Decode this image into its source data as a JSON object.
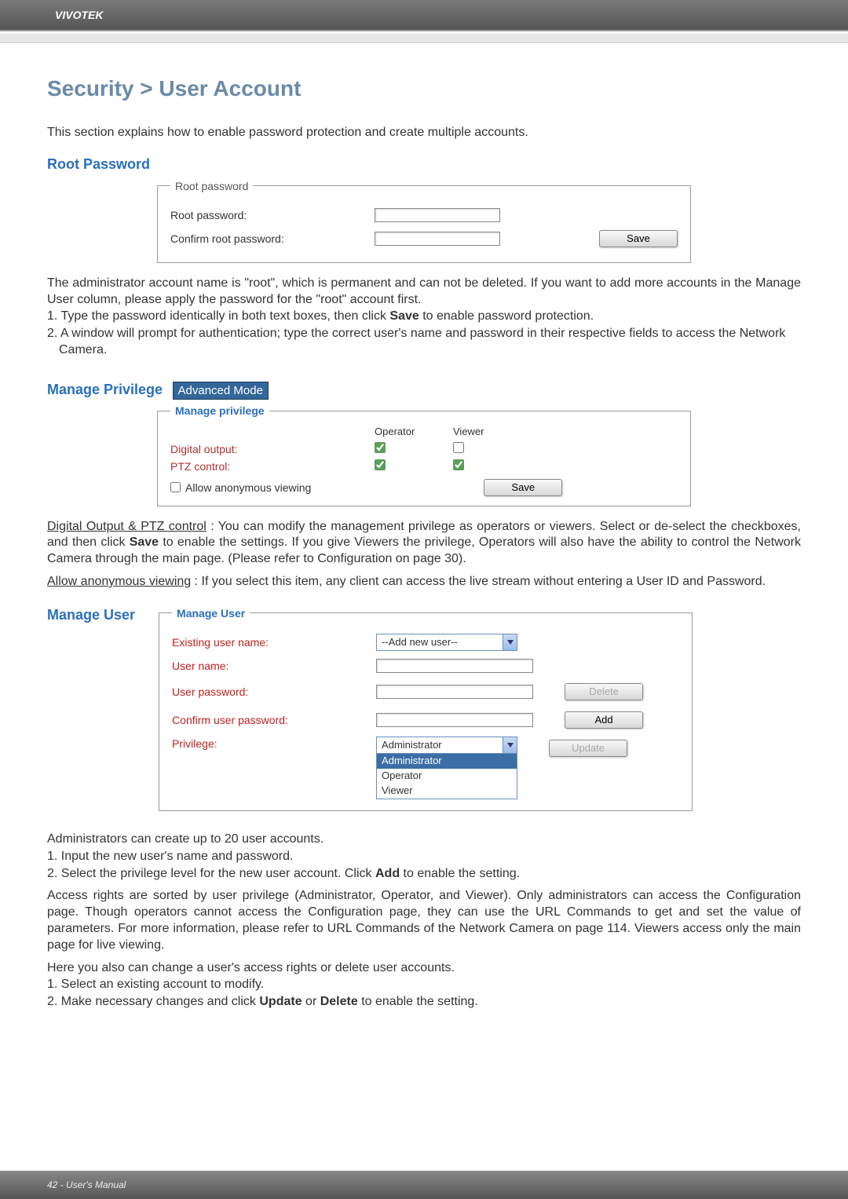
{
  "header": {
    "brand": "VIVOTEK"
  },
  "title": "Security > User Account",
  "intro": "This section explains how to enable password protection and create multiple accounts.",
  "root_password": {
    "heading": "Root Password",
    "legend": "Root password",
    "label1": "Root password:",
    "label2": "Confirm root password:",
    "save": "Save",
    "para1": "The administrator account name is \"root\", which is permanent and can not be deleted. If you want to add more accounts in the Manage User column, please apply the password for the \"root\" account first.",
    "step1": "1. Type the password identically in both text boxes, then click ",
    "step1b": "Save",
    "step1c": " to enable password protection.",
    "step2": "2. A window will prompt for authentication; type the correct user's name and password in their respective fields to access the Network Camera."
  },
  "manage_privilege": {
    "heading": "Manage Privilege",
    "badge": "Advanced Mode",
    "legend": "Manage privilege",
    "col1": "Operator",
    "col2": "Viewer",
    "row1": "Digital output:",
    "row1_op": true,
    "row1_vw": false,
    "row2": "PTZ control:",
    "row2_op": true,
    "row2_vw": true,
    "allow": "Allow anonymous viewing",
    "allow_checked": false,
    "save": "Save",
    "para_lead": "Digital Output & PTZ control",
    "para_body": ": You can modify the management privilege as operators or viewers. Select or de-select the checkboxes, and then click ",
    "para_save": "Save",
    "para_tail": " to enable the settings. If you give Viewers the privilege, Operators will also have the ability to control the Network Camera through the main page. (Please refer to Configuration on page 30).",
    "allow_lead": "Allow anonymous viewing",
    "allow_body": ": If you select this item, any client can access the live stream without entering a User ID and Password."
  },
  "manage_user": {
    "heading": "Manage User",
    "legend": "Manage User",
    "existing": "Existing user name:",
    "existing_val": "--Add new user--",
    "uname": "User name:",
    "upass": "User password:",
    "cpass": "Confirm user password:",
    "priv": "Privilege:",
    "priv_val": "Administrator",
    "opt1": "Administrator",
    "opt2": "Operator",
    "opt3": "Viewer",
    "delete": "Delete",
    "add": "Add",
    "update": "Update",
    "para1": "Administrators can create up to 20 user accounts.",
    "step1": "1. Input the new user's name and password.",
    "step2a": "2. Select the privilege level for the new user account. Click ",
    "step2b": "Add",
    "step2c": " to enable the setting.",
    "para2": "Access rights are sorted by user privilege (Administrator, Operator, and Viewer). Only administrators can access the Configuration page. Though operators cannot access the Configuration page, they can use the URL Commands to get and set the value of parameters. For more information, please refer to URL Commands of the Network Camera on page 114. Viewers access only the main page for live viewing.",
    "para3": "Here you also can change a user's access rights or delete user accounts.",
    "step3": "1. Select an existing account to modify.",
    "step4a": "2. Make necessary changes and click ",
    "step4b": "Update",
    "step4c": " or ",
    "step4d": "Delete",
    "step4e": " to enable the setting."
  },
  "footer": {
    "text": "42 - User's Manual"
  }
}
